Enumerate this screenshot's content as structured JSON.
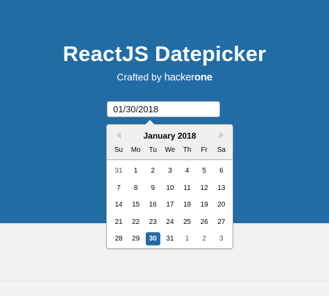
{
  "hero": {
    "title": "ReactJS Datepicker",
    "subtitle_prefix": "Crafted by",
    "brand_light": "hacker",
    "brand_bold": "one"
  },
  "datepicker": {
    "input_value": "01/30/2018",
    "month_title": "January 2018",
    "weekdays": [
      "Su",
      "Mo",
      "Tu",
      "We",
      "Th",
      "Fr",
      "Sa"
    ],
    "weeks": [
      [
        {
          "d": "31",
          "out": true
        },
        {
          "d": "1"
        },
        {
          "d": "2"
        },
        {
          "d": "3"
        },
        {
          "d": "4"
        },
        {
          "d": "5"
        },
        {
          "d": "6"
        }
      ],
      [
        {
          "d": "7"
        },
        {
          "d": "8"
        },
        {
          "d": "9"
        },
        {
          "d": "10"
        },
        {
          "d": "11"
        },
        {
          "d": "12"
        },
        {
          "d": "13"
        }
      ],
      [
        {
          "d": "14"
        },
        {
          "d": "15"
        },
        {
          "d": "16"
        },
        {
          "d": "17"
        },
        {
          "d": "18"
        },
        {
          "d": "19"
        },
        {
          "d": "20"
        }
      ],
      [
        {
          "d": "21"
        },
        {
          "d": "22"
        },
        {
          "d": "23"
        },
        {
          "d": "24"
        },
        {
          "d": "25"
        },
        {
          "d": "26"
        },
        {
          "d": "27"
        }
      ],
      [
        {
          "d": "28"
        },
        {
          "d": "29"
        },
        {
          "d": "30",
          "selected": true
        },
        {
          "d": "31"
        },
        {
          "d": "1",
          "out": true
        },
        {
          "d": "2",
          "out": true
        },
        {
          "d": "3",
          "out": true
        }
      ]
    ],
    "icons": {
      "prev": "chevron-left-icon",
      "next": "chevron-right-icon"
    }
  },
  "colors": {
    "hero_bg": "#226ca6",
    "selected_day": "#216ba5",
    "page_bg": "#f2f2f2"
  }
}
